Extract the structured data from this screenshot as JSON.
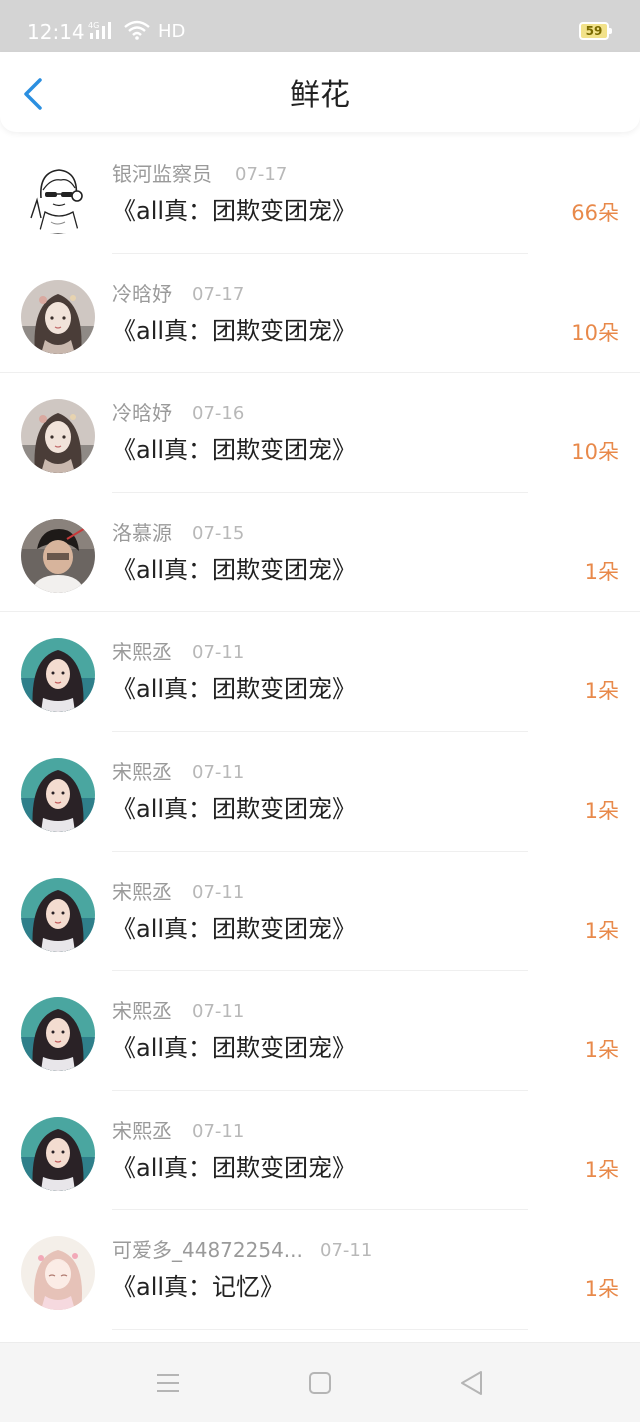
{
  "status_bar": {
    "time": "12:14",
    "network": "4G",
    "hd": "HD",
    "battery": "59"
  },
  "header": {
    "back_icon": "chevron-left-icon",
    "title": "鲜花"
  },
  "colors": {
    "accent": "#2b8fe0",
    "count": "#e8894a",
    "status_bar_bg": "#d4d4d4"
  },
  "records": [
    {
      "user": "银河监察员",
      "date": "07-17",
      "book": "《all真：团欺变团宠》",
      "count": "66朵",
      "avatar": "sketch-character-avatar"
    },
    {
      "user": "冷晗妤",
      "date": "07-17",
      "book": "《all真：团欺变团宠》",
      "count": "10朵",
      "avatar": "anime-girl-avatar"
    },
    {
      "user": "冷晗妤",
      "date": "07-16",
      "book": "《all真：团欺变团宠》",
      "count": "10朵",
      "avatar": "anime-girl-avatar"
    },
    {
      "user": "洛慕源",
      "date": "07-15",
      "book": "《all真：团欺变团宠》",
      "count": "1朵",
      "avatar": "photo-avatar"
    },
    {
      "user": "宋熙丞",
      "date": "07-11",
      "book": "《all真：团欺变团宠》",
      "count": "1朵",
      "avatar": "girl-photo-avatar"
    },
    {
      "user": "宋熙丞",
      "date": "07-11",
      "book": "《all真：团欺变团宠》",
      "count": "1朵",
      "avatar": "girl-photo-avatar"
    },
    {
      "user": "宋熙丞",
      "date": "07-11",
      "book": "《all真：团欺变团宠》",
      "count": "1朵",
      "avatar": "girl-photo-avatar"
    },
    {
      "user": "宋熙丞",
      "date": "07-11",
      "book": "《all真：团欺变团宠》",
      "count": "1朵",
      "avatar": "girl-photo-avatar"
    },
    {
      "user": "宋熙丞",
      "date": "07-11",
      "book": "《all真：团欺变团宠》",
      "count": "1朵",
      "avatar": "girl-photo-avatar"
    },
    {
      "user": "可爱多_44872254...",
      "date": "07-11",
      "book": "《all真：记忆》",
      "count": "1朵",
      "avatar": "pink-anime-avatar"
    }
  ],
  "nav_bar": {
    "menu_icon": "menu-icon",
    "home_icon": "home-square-icon",
    "back_icon": "back-triangle-icon"
  }
}
